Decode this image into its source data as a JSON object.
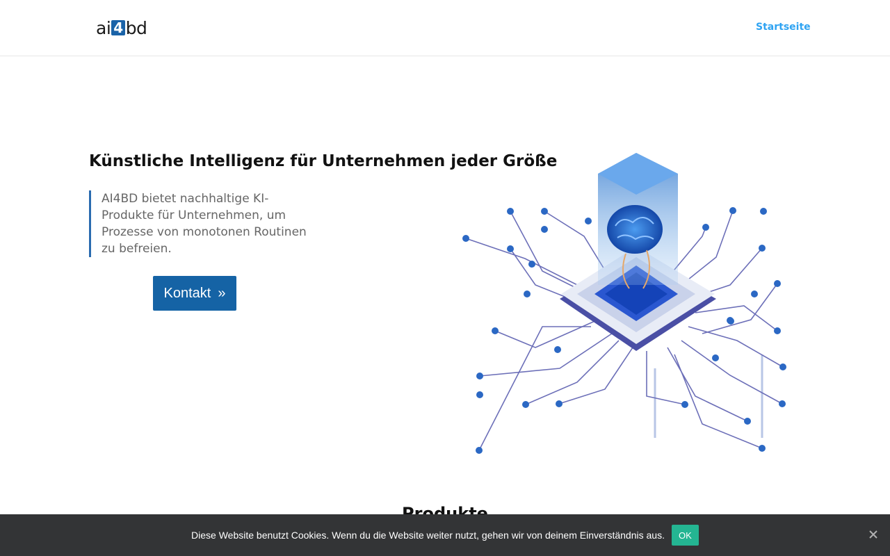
{
  "header": {
    "logo": {
      "part1": "ai",
      "part2": "4",
      "part3": "bd"
    },
    "nav": [
      {
        "label": "Startseite"
      }
    ]
  },
  "hero": {
    "title": "Künstliche Intelligenz für Unternehmen jeder Größe",
    "description": "AI4BD bietet nachhaltige KI-Produkte für Unternehmen, um Prozesse von monotonen Routinen zu befreien.",
    "cta": {
      "label": "Kontakt",
      "arrow": "»"
    }
  },
  "section": {
    "title": "Produkte"
  },
  "cookie": {
    "text": "Diese Website benutzt Cookies. Wenn du die Website weiter nutzt, gehen wir von deinem Einverständnis aus.",
    "ok_label": "OK"
  },
  "colors": {
    "brand": "#1563a5",
    "nav_link": "#2ea3f2",
    "cookie_bg": "#333436",
    "cookie_ok": "#24b592"
  },
  "icons": {
    "illustration": "ai-brain-chip-illustration",
    "close": "close-icon"
  }
}
